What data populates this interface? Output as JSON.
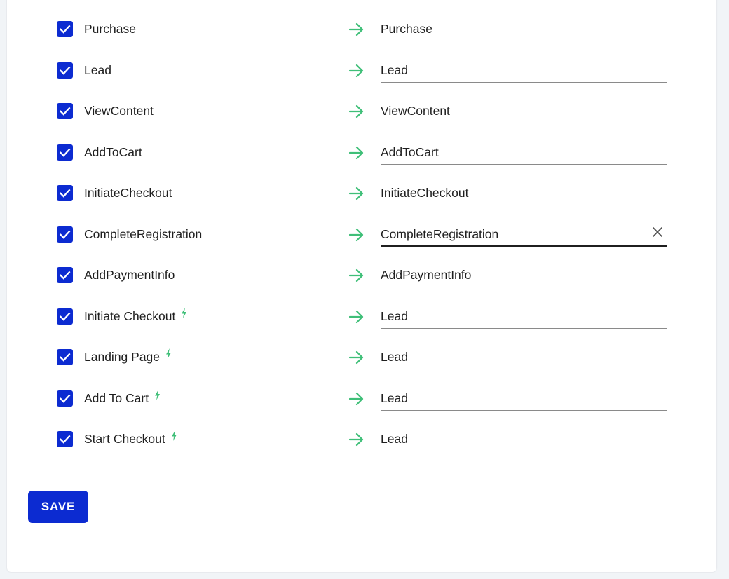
{
  "colors": {
    "accent": "#0c2bd1",
    "arrow": "#3fbf78",
    "bolt": "#3fbf78",
    "text": "#1f1f1f",
    "background": "#f1f4f7"
  },
  "icons": {
    "checkbox": "checkmark-icon",
    "arrow": "arrow-right-icon",
    "bolt": "lightning-bolt-icon",
    "clear": "close-icon"
  },
  "mappings": [
    {
      "event": "Purchase",
      "checked": true,
      "custom": false,
      "target": "Purchase",
      "focused": false
    },
    {
      "event": "Lead",
      "checked": true,
      "custom": false,
      "target": "Lead",
      "focused": false
    },
    {
      "event": "ViewContent",
      "checked": true,
      "custom": false,
      "target": "ViewContent",
      "focused": false
    },
    {
      "event": "AddToCart",
      "checked": true,
      "custom": false,
      "target": "AddToCart",
      "focused": false
    },
    {
      "event": "InitiateCheckout",
      "checked": true,
      "custom": false,
      "target": "InitiateCheckout",
      "focused": false
    },
    {
      "event": "CompleteRegistration",
      "checked": true,
      "custom": false,
      "target": "CompleteRegistration",
      "focused": true
    },
    {
      "event": "AddPaymentInfo",
      "checked": true,
      "custom": false,
      "target": "AddPaymentInfo",
      "focused": false
    },
    {
      "event": "Initiate Checkout",
      "checked": true,
      "custom": true,
      "target": "Lead",
      "focused": false
    },
    {
      "event": "Landing Page",
      "checked": true,
      "custom": true,
      "target": "Lead",
      "focused": false
    },
    {
      "event": "Add To Cart",
      "checked": true,
      "custom": true,
      "target": "Lead",
      "focused": false
    },
    {
      "event": "Start Checkout",
      "checked": true,
      "custom": true,
      "target": "Lead",
      "focused": false
    }
  ],
  "save_label": "SAVE"
}
